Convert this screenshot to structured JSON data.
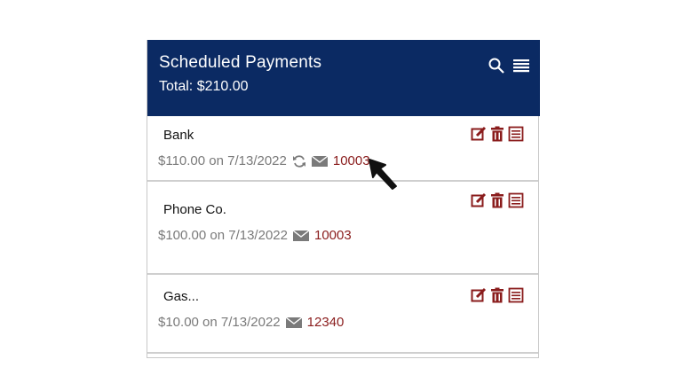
{
  "header": {
    "title": "Scheduled Payments",
    "total": "Total: $210.00",
    "icons": [
      "search-icon",
      "menu-icon"
    ]
  },
  "payments": [
    {
      "payee": "Bank",
      "summary": "$110.00 on 7/13/2022",
      "recurring": true,
      "code": "10003"
    },
    {
      "payee": "Phone Co.",
      "summary": "$100.00 on 7/13/2022",
      "recurring": false,
      "code": "10003"
    },
    {
      "payee": "Gas...",
      "summary": "$10.00 on 7/13/2022",
      "recurring": false,
      "code": "12340"
    }
  ],
  "row_actions": [
    "edit-icon",
    "delete-icon",
    "details-icon"
  ],
  "colors": {
    "header_bg": "#0b2a63",
    "accent": "#8a1c1c",
    "muted_text": "#7a7a7a"
  }
}
